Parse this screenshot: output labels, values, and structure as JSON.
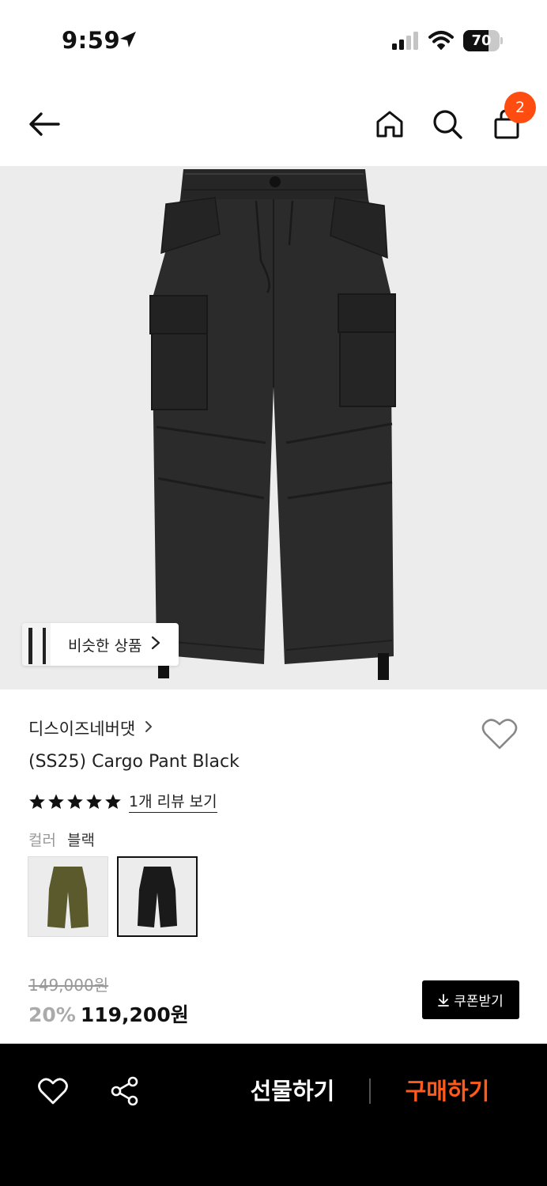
{
  "status_bar": {
    "time": "9:59",
    "battery": "70",
    "battery_level": 0.7,
    "icons": [
      "location-arrow-icon",
      "cellular-signal-icon",
      "wifi-icon",
      "battery-icon"
    ]
  },
  "nav": {
    "icons": [
      "back-arrow-icon",
      "home-icon",
      "search-icon",
      "shopping-bag-icon"
    ],
    "cart_count": "2"
  },
  "product": {
    "similar_label": "비슷한 상품",
    "brand": "디스이즈네버댓",
    "title": "(SS25) Cargo Pant Black",
    "rating_stars": 5,
    "review_link": "1개 리뷰 보기",
    "color_label": "컬러",
    "color_value": "블랙",
    "swatches": [
      {
        "name": "olive",
        "color": "#5a5a2c",
        "selected": false
      },
      {
        "name": "black",
        "color": "#1a1a1a",
        "selected": true
      }
    ]
  },
  "price": {
    "original": "149,000원",
    "discount": "20%",
    "final": "119,200원",
    "coupon_label": "쿠폰받기"
  },
  "bottom_bar": {
    "gift_label": "선물하기",
    "buy_label": "구매하기",
    "icons": [
      "heart-outline-icon",
      "share-icon"
    ]
  },
  "colors": {
    "accent": "#ff4d12",
    "buy_text": "#ff5a1a",
    "image_bg": "#ececec",
    "bottom_bar_bg": "#000000"
  }
}
